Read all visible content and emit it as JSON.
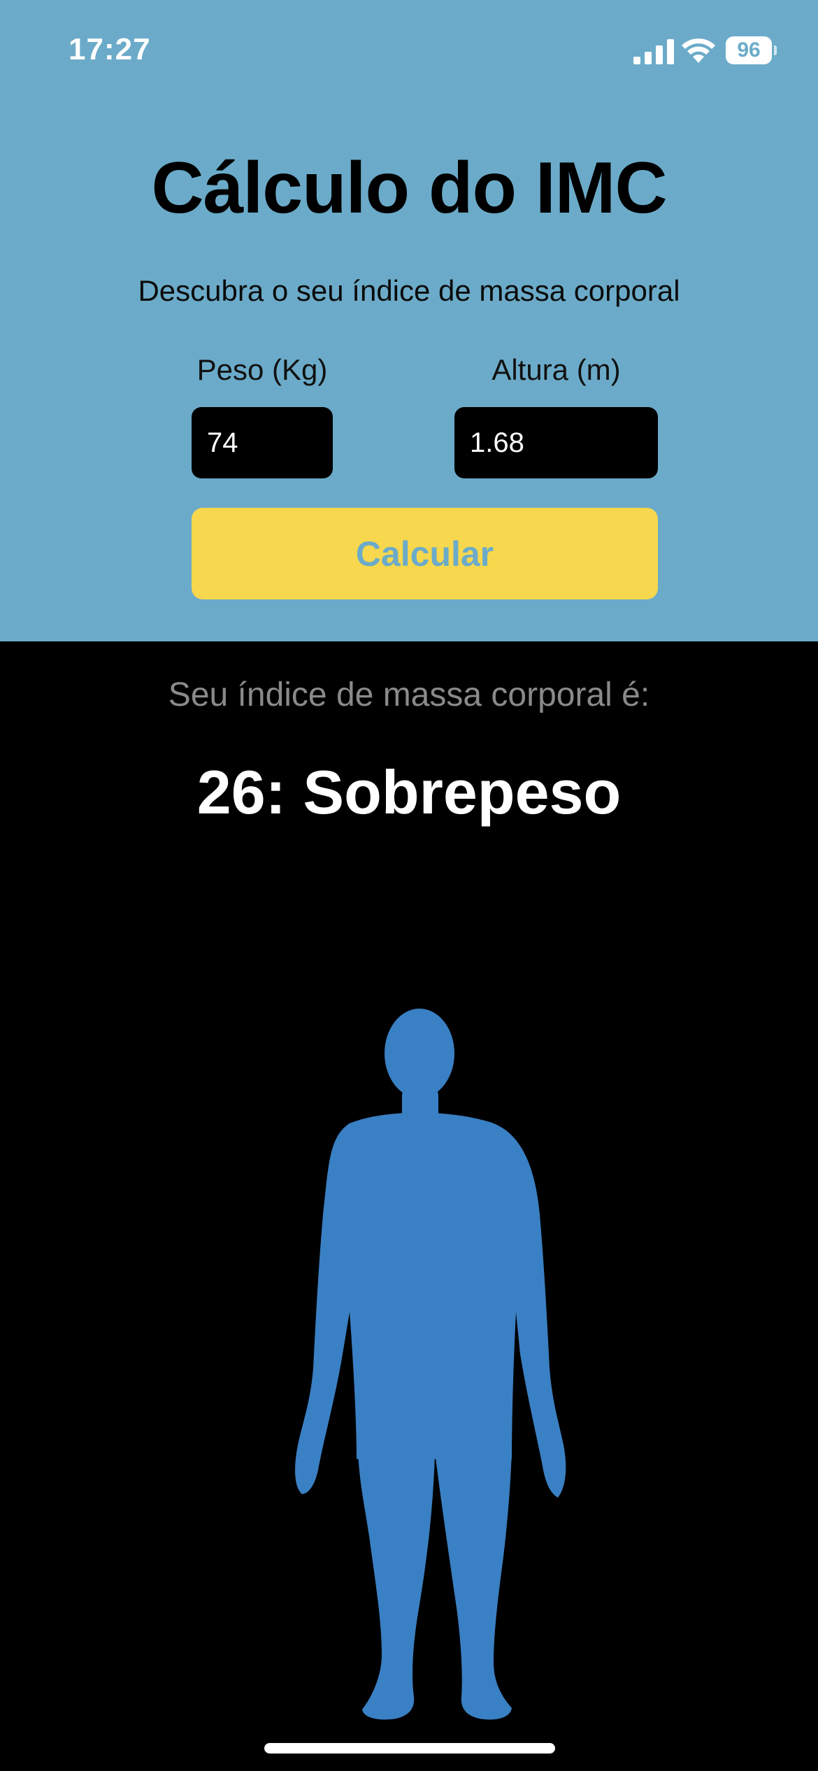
{
  "status_bar": {
    "time": "17:27",
    "battery": "96",
    "icons": [
      "signal-icon",
      "wifi-icon",
      "battery-icon"
    ]
  },
  "header": {
    "title": "Cálculo do IMC",
    "subtitle": "Descubra o seu índice de massa corporal"
  },
  "form": {
    "weight_label": "Peso (Kg)",
    "weight_value": "74",
    "height_label": "Altura (m)",
    "height_value": "1.68",
    "calculate_label": "Calcular"
  },
  "result": {
    "label": "Seu índice de massa corporal é:",
    "value": "26: Sobrepeso"
  },
  "colors": {
    "header_background": "#6BABC9",
    "button_background": "#F7D74D",
    "button_text": "#6BABC9",
    "silhouette": "#3A80C4",
    "result_background": "#000000"
  }
}
